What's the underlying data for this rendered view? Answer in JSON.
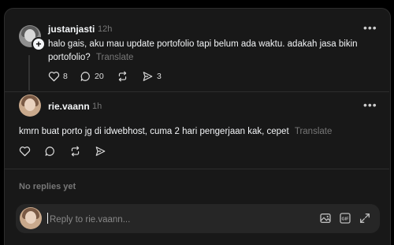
{
  "post": {
    "username": "justanjasti",
    "time": "12h",
    "text": "halo gais, aku mau update portofolio tapi belum ada waktu. adakah jasa bikin portofolio?",
    "translate": "Translate",
    "likes": "8",
    "replies": "20",
    "shares": "3"
  },
  "reply": {
    "username": "rie.vaann",
    "time": "1h",
    "text": "kmrn buat porto jg di idwebhost, cuma 2 hari pengerjaan kak, cepet",
    "translate": "Translate"
  },
  "no_replies": "No replies yet",
  "composer": {
    "placeholder": "Reply to rie.vaann..."
  },
  "icons": {
    "more": "more-options-icon",
    "like": "heart-icon",
    "comment": "comment-icon",
    "repost": "repost-icon",
    "share": "send-icon",
    "image": "image-icon",
    "gif": "gif-icon",
    "expand": "expand-icon"
  }
}
